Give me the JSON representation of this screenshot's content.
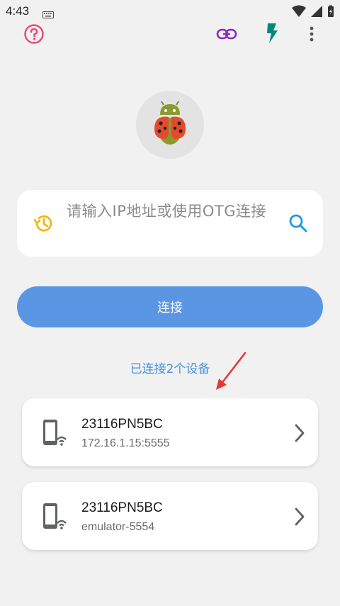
{
  "status_bar": {
    "time": "4:43",
    "icons": [
      "keyboard-icon",
      "wifi-icon",
      "signal-icon",
      "battery-charging-icon"
    ]
  },
  "toolbar": {
    "icons": [
      "help-icon",
      "link-icon",
      "flash-icon",
      "more-vert-icon"
    ],
    "colors": {
      "help": "#e84d7a",
      "link": "#8a2bbf",
      "flash": "#00897b",
      "more": "#555555"
    }
  },
  "logo": {
    "icon": "ladybug-android-logo"
  },
  "input": {
    "placeholder": "请输入IP地址或使用OTG连接",
    "left_icon": "history-icon",
    "right_icon": "search-icon"
  },
  "connect_button": {
    "label": "连接",
    "color": "#5b96e4"
  },
  "connected_label": "已连接2个设备",
  "devices": [
    {
      "name": "23116PN5BC",
      "address": "172.16.1.15:5555",
      "icon": "phone-wifi-icon"
    },
    {
      "name": "23116PN5BC",
      "address": "emulator-5554",
      "icon": "phone-wifi-icon"
    }
  ]
}
